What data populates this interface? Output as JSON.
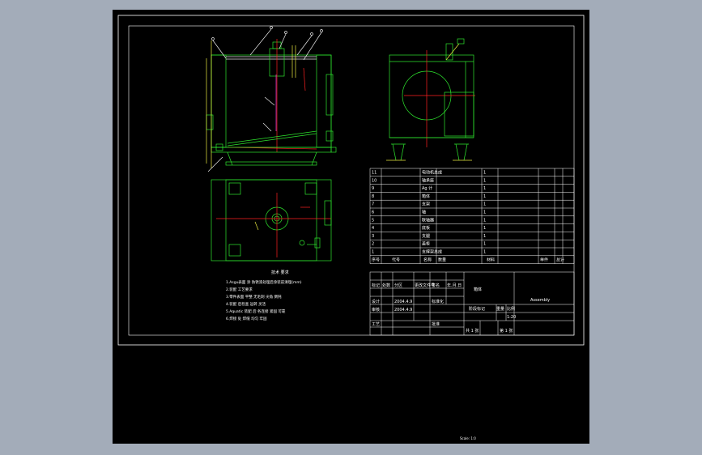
{
  "drawing": {
    "main_title": "Assembly",
    "scale_text": "Scale: 1:0",
    "notes_title": "技术 要求",
    "notes": [
      "1.Asgu表面 涂 防锈漆处理后涂装前清理(mm)",
      "2.装配 工艺要求",
      "3.零件表面 平整 无毛刺 尖角 倒钝",
      "4.装配 后检查 运转 灵活",
      "5.Aquatic 装配 后 各连接 紧固 可靠",
      "6.焊接 处 焊缝 均匀 牢固"
    ],
    "bom_rows": [
      {
        "no": "11",
        "name": "电动机总成",
        "qty": "1",
        "note": ""
      },
      {
        "no": "10",
        "name": "轴承座",
        "qty": "1",
        "note": ""
      },
      {
        "no": "9",
        "name": "Ag 计",
        "qty": "1",
        "note": ""
      },
      {
        "no": "8",
        "name": "箱体",
        "qty": "1",
        "note": ""
      },
      {
        "no": "7",
        "name": "支架",
        "qty": "1",
        "note": ""
      },
      {
        "no": "6",
        "name": "轴",
        "qty": "1",
        "note": ""
      },
      {
        "no": "5",
        "name": "联轴器",
        "qty": "1",
        "note": ""
      },
      {
        "no": "4",
        "name": "底板",
        "qty": "1",
        "note": ""
      },
      {
        "no": "3",
        "name": "支腿",
        "qty": "1",
        "note": ""
      },
      {
        "no": "2",
        "name": "盖板",
        "qty": "1",
        "note": ""
      },
      {
        "no": "1",
        "name": "支撑架总成",
        "qty": "1",
        "note": ""
      }
    ],
    "bom_header": {
      "no": "序号",
      "code": "代号",
      "name": "名称",
      "qty": "数量",
      "material": "材料",
      "unit": "单件",
      "total": "总计",
      "weight": "重量",
      "remark": "备注"
    },
    "title_block": {
      "part_name": "箱体",
      "drawing_no": "Agu0018",
      "mark": "标记",
      "count": "处数",
      "zone": "分区",
      "change_doc": "更改文件号",
      "sign": "签名",
      "date": "年.月.日",
      "designer": "设计",
      "designer_name": "标准化",
      "check": "审核",
      "process": "工艺",
      "approve": "批准",
      "stage": "阶段标记",
      "weight": "重量",
      "scale": "比例",
      "scale_val": "1:20",
      "sheet": "共 1 张",
      "sheet_of": "第 1 张",
      "date1": "2004.4.9",
      "date2": "2004.4.9"
    }
  },
  "colors": {
    "background": "#a3acb9",
    "viewport": "#000000",
    "geometry": "#2ee62e",
    "centerline": "#ff2020",
    "annotation": "#e8e840",
    "frame": "#ffffff"
  }
}
